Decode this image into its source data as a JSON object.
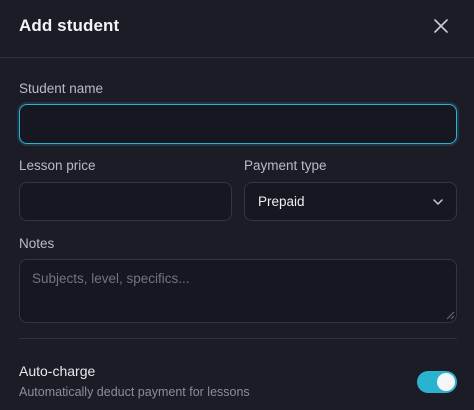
{
  "dialog": {
    "title": "Add student",
    "close_icon": "close-icon"
  },
  "form": {
    "student_name": {
      "label": "Student name",
      "value": "",
      "placeholder": ""
    },
    "lesson_price": {
      "label": "Lesson price",
      "value": "",
      "placeholder": ""
    },
    "payment_type": {
      "label": "Payment type",
      "selected": "Prepaid",
      "icon": "chevron-down-icon"
    },
    "notes": {
      "label": "Notes",
      "value": "",
      "placeholder": "Subjects, level, specifics..."
    }
  },
  "auto_charge": {
    "title": "Auto-charge",
    "description": "Automatically deduct payment for lessons",
    "enabled": true
  },
  "colors": {
    "background": "#1b1c25",
    "field_background": "#161720",
    "accent": "#2ab3d1",
    "border": "#34363f"
  }
}
